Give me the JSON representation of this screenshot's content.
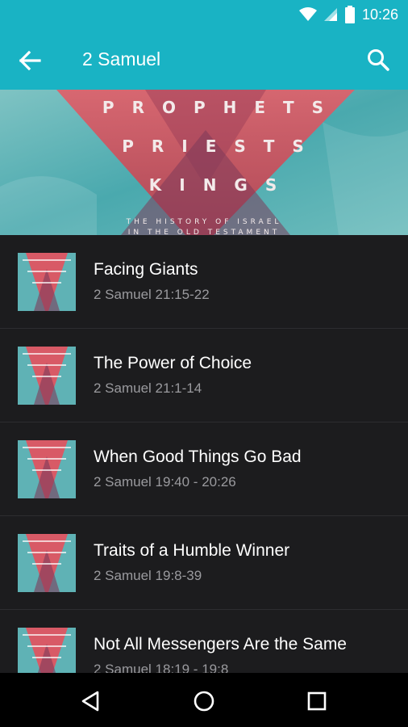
{
  "status": {
    "time": "10:26"
  },
  "appbar": {
    "title": "2 Samuel"
  },
  "hero": {
    "line1": "PROPHETS",
    "line2": "PRIESTS",
    "line3": "KINGS",
    "subtitle_line1": "THE HISTORY OF ISRAEL",
    "subtitle_line2": "IN THE OLD TESTAMENT"
  },
  "sermons": [
    {
      "title": "Facing Giants",
      "reference": "2 Samuel 21:15-22"
    },
    {
      "title": "The Power of Choice",
      "reference": "2 Samuel 21:1-14"
    },
    {
      "title": "When Good Things Go Bad",
      "reference": "2 Samuel 19:40 - 20:26"
    },
    {
      "title": "Traits of a Humble Winner",
      "reference": "2 Samuel 19:8-39"
    },
    {
      "title": "Not All Messengers Are the Same",
      "reference": "2 Samuel 18:19 - 19:8"
    }
  ],
  "colors": {
    "accent": "#19b3c4",
    "background": "#1c1c1e",
    "secondary_text": "#9a9a9e"
  },
  "icons": [
    "wifi-icon",
    "signal-icon",
    "battery-icon",
    "back-arrow-icon",
    "search-icon",
    "nav-back-icon",
    "nav-home-icon",
    "nav-recents-icon"
  ]
}
